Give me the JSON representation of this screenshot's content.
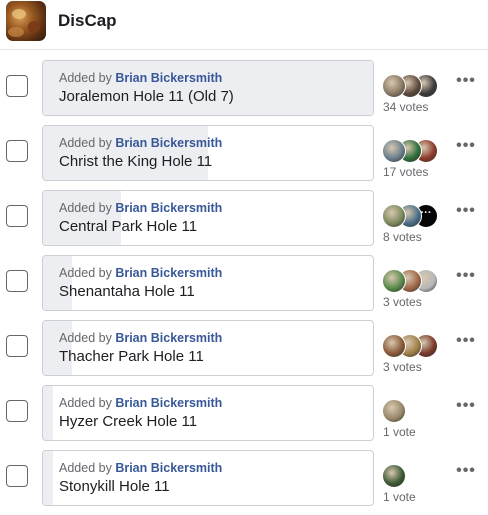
{
  "group": {
    "name": "DisCap"
  },
  "poll": {
    "options": [
      {
        "added_prefix": "Added by",
        "added_by": "Brian Bickersmith",
        "label": "Joralemon Hole 11 (Old 7)",
        "vote_count_text": "34 votes",
        "vote_share": 1.0,
        "voter_colors": [
          "#8a7a66",
          "#5d4a3c",
          "#3b3b3b"
        ],
        "has_more_badge": false
      },
      {
        "added_prefix": "Added by",
        "added_by": "Brian Bickersmith",
        "label": "Christ the King Hole 11",
        "vote_count_text": "17 votes",
        "vote_share": 0.5,
        "voter_colors": [
          "#6b7f8e",
          "#2f6e3a",
          "#8c3b2b"
        ],
        "has_more_badge": false
      },
      {
        "added_prefix": "Added by",
        "added_by": "Brian Bickersmith",
        "label": "Central Park Hole 11",
        "vote_count_text": "8 votes",
        "vote_share": 0.235,
        "voter_colors": [
          "#7b8a5c",
          "#4a6f88",
          "#050505"
        ],
        "has_more_badge": true
      },
      {
        "added_prefix": "Added by",
        "added_by": "Brian Bickersmith",
        "label": "Shenantaha Hole 11",
        "vote_count_text": "3 votes",
        "vote_share": 0.088,
        "voter_colors": [
          "#5a8a4a",
          "#a06848",
          "#b8b8b8"
        ],
        "has_more_badge": false
      },
      {
        "added_prefix": "Added by",
        "added_by": "Brian Bickersmith",
        "label": "Thacher Park Hole 11",
        "vote_count_text": "3 votes",
        "vote_share": 0.088,
        "voter_colors": [
          "#8a5a3a",
          "#a08048",
          "#7a3a2a"
        ],
        "has_more_badge": false
      },
      {
        "added_prefix": "Added by",
        "added_by": "Brian Bickersmith",
        "label": "Hyzer Creek Hole 11",
        "vote_count_text": "1 vote",
        "vote_share": 0.029,
        "voter_colors": [
          "#9a8a6a"
        ],
        "has_more_badge": false
      },
      {
        "added_prefix": "Added by",
        "added_by": "Brian Bickersmith",
        "label": "Stonykill Hole 11",
        "vote_count_text": "1 vote",
        "vote_share": 0.029,
        "voter_colors": [
          "#3e5a36"
        ],
        "has_more_badge": false
      }
    ],
    "more_badge_text": "···",
    "more_menu_text": "•••"
  }
}
